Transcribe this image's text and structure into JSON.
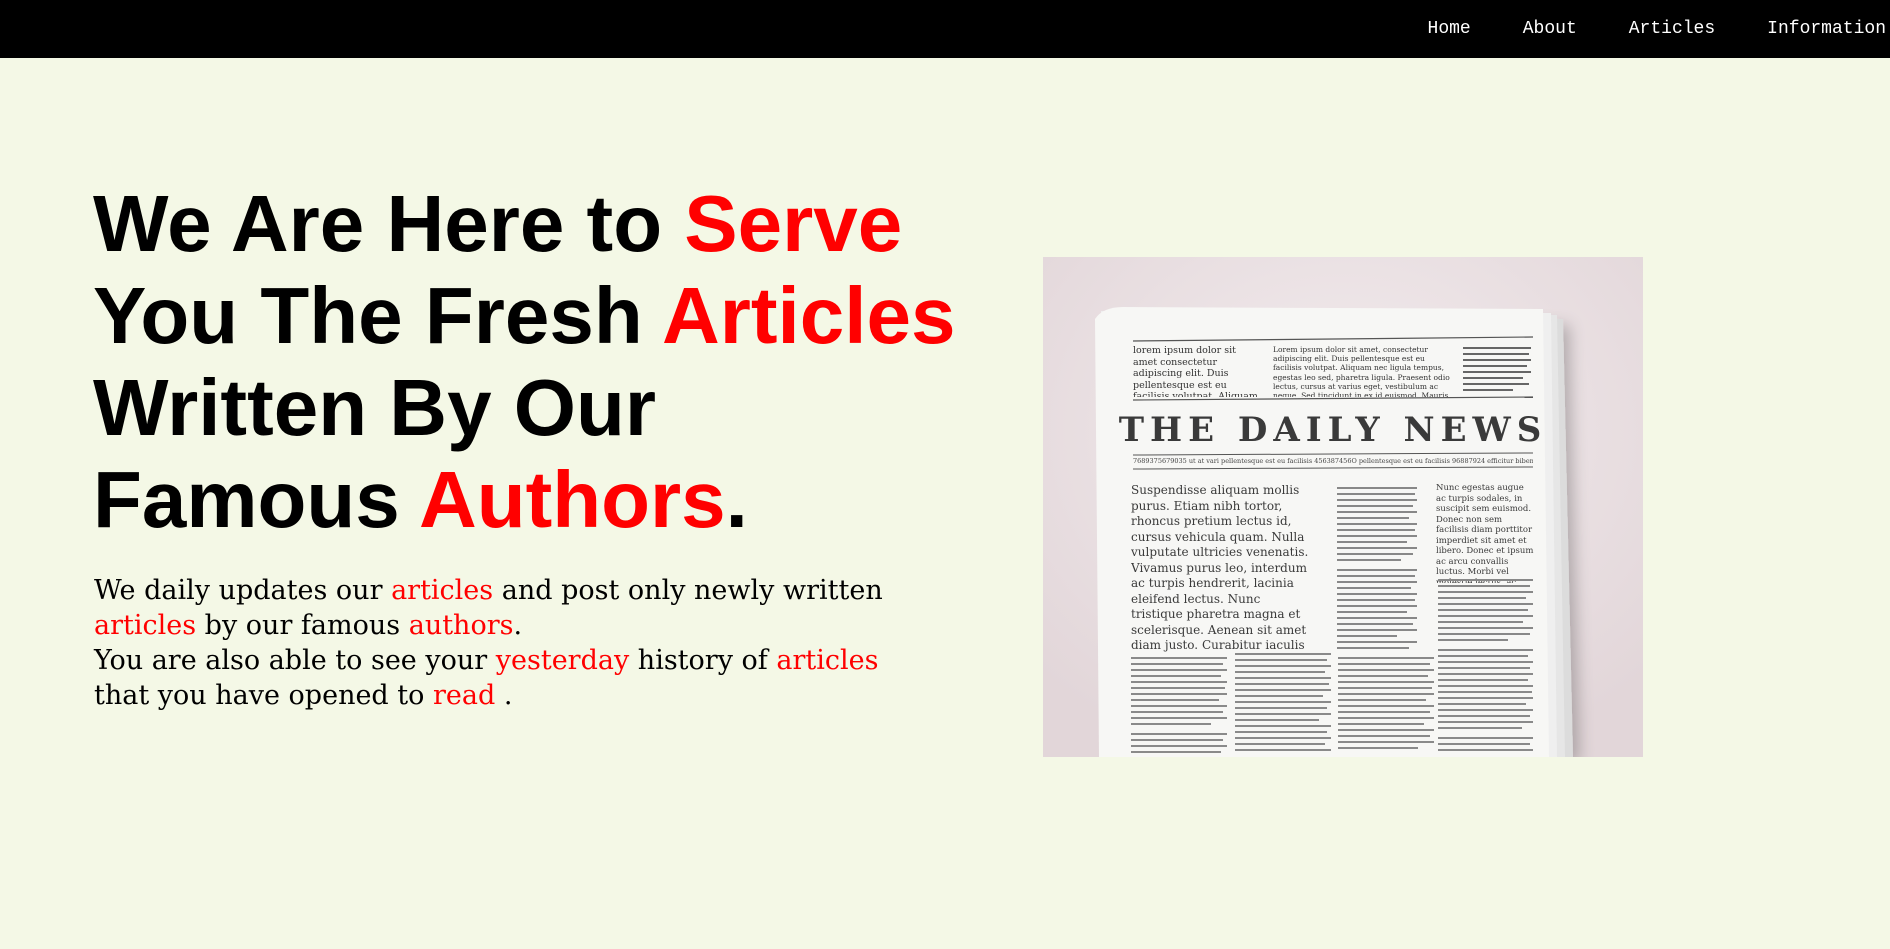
{
  "nav": {
    "items": [
      "Home",
      "About",
      "Articles",
      "Information"
    ]
  },
  "hero": {
    "title": {
      "p1": "We Are Here to ",
      "p2": "Serve",
      "p3": " You The Fresh ",
      "p4": "Articles",
      "p5": " Written By Our Famous ",
      "p6": "Authors",
      "p7": "."
    },
    "description": {
      "line1": {
        "a": "We daily updates our ",
        "b": "articles",
        "c": " and post only newly written"
      },
      "line2": {
        "a": "articles",
        "b": " by our famous ",
        "c": "authors",
        "d": "."
      },
      "line3": {
        "a": "You are also able to see your ",
        "b": "yesterday",
        "c": " history of ",
        "d": "articles"
      },
      "line4": {
        "a": "that you have opened to ",
        "b": "read",
        "c": " ."
      }
    }
  },
  "newspaper": {
    "masthead": "THE DAILY NEWS",
    "dateline": "7689375679035  ut at vari pellentesque est eu facilisis 456387456O pellentesque est eu facilisis 96887924 efficitur bibendum",
    "top_left": "lorem ipsum dolor sit amet consectetur adipiscing elit. Duis pellentesque est eu facilisis volutpat. Aliquam nec",
    "top_middle": "Lorem ipsum dolor sit amet, consectetur adipiscing elit. Duis pellentesque est eu facilisis volutpat. Aliquam nec ligula tempus, egestas leo sed, pharetra ligula. Praesent odio lectus, cursus at varius eget, vestibulum ac neque. Sed tincidunt in ex id euismod. Mauris efficitur bibendum nulla sed placerat.",
    "lead": "Suspendisse aliquam mollis purus. Etiam nibh tortor, rhoncus pretium lectus id, cursus vehicula quam. Nulla vulputate ultricies venenatis. Vivamus purus leo, interdum ac turpis hendrerit, lacinia eleifend lectus. Nunc tristique pharetra magna et scelerisque. Aenean sit amet diam justo. Curabitur iaculis ultricies enim, non accumsan justo congue quis.",
    "right_lead": "Nunc egestas augue ac turpis sodales, in suscipit sem euismod. Donec non sem facilisis diam porttitor imperdiet sit amet et libero. Donec et ipsum ac arcu convallis luctus. Morbi vel molestie lectus, ac eleifend massa."
  },
  "colors": {
    "accent": "#ff0000",
    "background": "#f4f8e6",
    "nav_background": "#000000",
    "nav_text": "#ffffff"
  }
}
